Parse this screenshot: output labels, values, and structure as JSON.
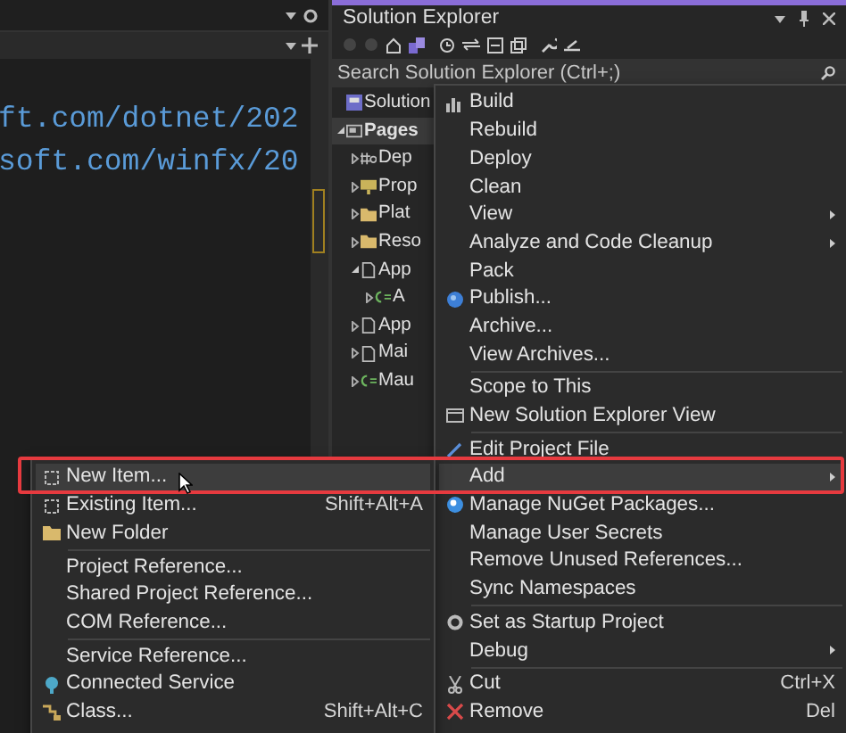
{
  "editor": {
    "code_lines": [
      "ft.com/dotnet/202",
      "soft.com/winfx/20"
    ]
  },
  "solution_explorer": {
    "title": "Solution Explorer",
    "search": {
      "placeholder": "Search Solution Explorer (Ctrl+;)"
    },
    "tree": [
      {
        "label": "Solution",
        "kind": "solution",
        "selected": false
      },
      {
        "label": "Pages",
        "kind": "project",
        "selected": true,
        "expanded": true,
        "children": [
          {
            "label": "Dep",
            "kind": "dependencies",
            "selected": false,
            "expanded": false
          },
          {
            "label": "Prop",
            "kind": "properties",
            "selected": false,
            "expanded": false
          },
          {
            "label": "Plat",
            "kind": "folder",
            "selected": false,
            "expanded": false
          },
          {
            "label": "Reso",
            "kind": "folder",
            "selected": false,
            "expanded": false
          },
          {
            "label": "App",
            "kind": "file",
            "selected": false,
            "expanded": true,
            "children": [
              {
                "label": "A",
                "kind": "csharp",
                "selected": false,
                "expanded": false
              }
            ]
          },
          {
            "label": "App",
            "kind": "file",
            "selected": false,
            "expanded": false
          },
          {
            "label": "Mai",
            "kind": "file",
            "selected": false,
            "expanded": false
          },
          {
            "label": "Mau",
            "kind": "csharp",
            "selected": false,
            "expanded": false
          }
        ]
      }
    ]
  },
  "context_menu": {
    "items": [
      {
        "label": "Build",
        "kind": "build",
        "selected": false
      },
      {
        "label": "Rebuild",
        "selected": false
      },
      {
        "label": "Deploy",
        "selected": false
      },
      {
        "label": "Clean",
        "selected": false
      },
      {
        "label": "View",
        "selected": false,
        "submenu": true
      },
      {
        "label": "Analyze and Code Cleanup",
        "selected": false,
        "submenu": true
      },
      {
        "label": "Pack",
        "selected": false
      },
      {
        "label": "Publish...",
        "kind": "publish",
        "selected": false
      },
      {
        "label": "Archive...",
        "selected": false
      },
      {
        "label": "View Archives...",
        "selected": false
      },
      {
        "label": "Scope to This",
        "selected": false,
        "separator_before": true
      },
      {
        "label": "New Solution Explorer View",
        "kind": "window",
        "selected": false
      },
      {
        "label": "Edit Project File",
        "kind": "edit",
        "selected": false,
        "separator_before": true
      },
      {
        "label": "Add",
        "selected": true,
        "submenu": true
      },
      {
        "label": "Manage NuGet Packages...",
        "kind": "nuget",
        "selected": false
      },
      {
        "label": "Manage User Secrets",
        "selected": false
      },
      {
        "label": "Remove Unused References...",
        "selected": false
      },
      {
        "label": "Sync Namespaces",
        "selected": false
      },
      {
        "label": "Set as Startup Project",
        "kind": "gear",
        "selected": false,
        "separator_before": true
      },
      {
        "label": "Debug",
        "selected": false,
        "submenu": true
      },
      {
        "label": "Cut",
        "kind": "cut",
        "shortcut": "Ctrl+X",
        "selected": false,
        "separator_before": true
      },
      {
        "label": "Remove",
        "kind": "remove",
        "shortcut": "Del",
        "selected": false
      }
    ]
  },
  "add_submenu": {
    "items": [
      {
        "label": "New Item...",
        "kind": "new-item",
        "selected": true
      },
      {
        "label": "Existing Item...",
        "kind": "new-item",
        "shortcut": "Shift+Alt+A",
        "selected": false
      },
      {
        "label": "New Folder",
        "kind": "folder",
        "selected": false
      },
      {
        "label": "Project Reference...",
        "selected": false,
        "separator_before": true
      },
      {
        "label": "Shared Project Reference...",
        "selected": false
      },
      {
        "label": "COM Reference...",
        "selected": false
      },
      {
        "label": "Service Reference...",
        "selected": false,
        "separator_before": true
      },
      {
        "label": "Connected Service",
        "kind": "service",
        "selected": false
      },
      {
        "label": "Class...",
        "kind": "class",
        "shortcut": "Shift+Alt+C",
        "selected": false
      }
    ]
  }
}
